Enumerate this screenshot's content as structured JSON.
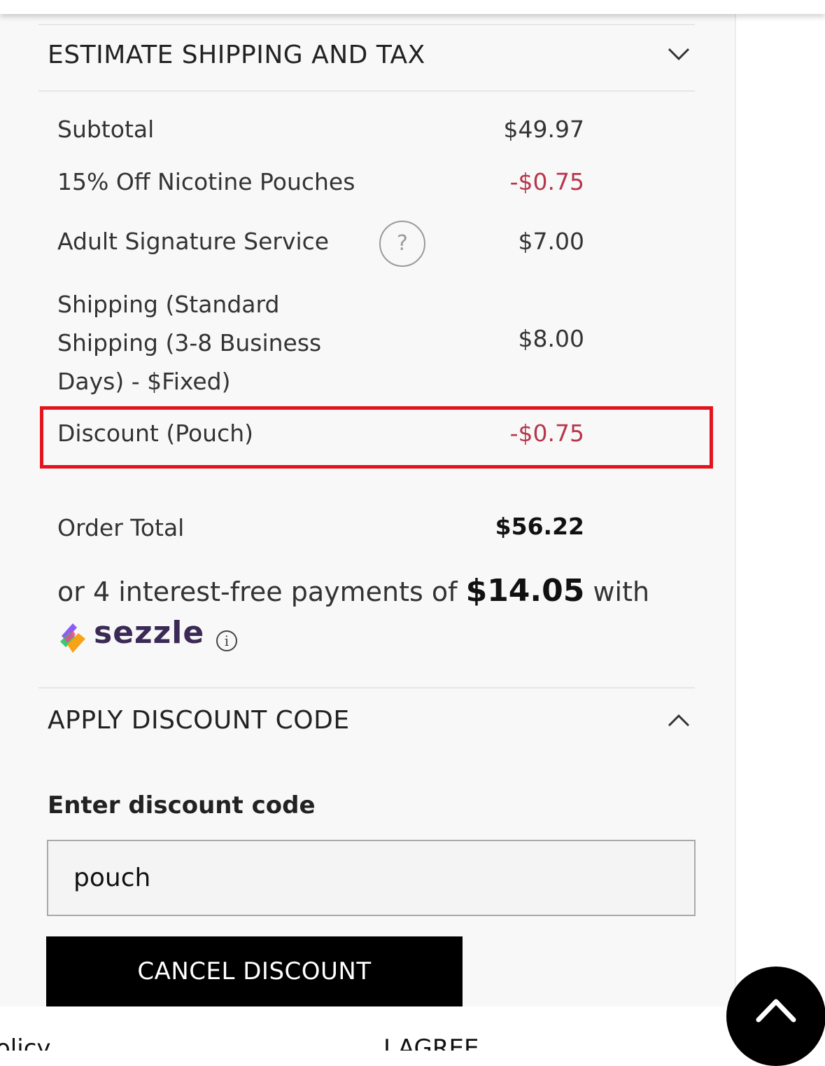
{
  "shipping_section": {
    "title": "ESTIMATE SHIPPING AND TAX"
  },
  "summary": {
    "rows": [
      {
        "label": "Subtotal",
        "value": "$49.97"
      },
      {
        "label": "15% Off Nicotine Pouches",
        "value": "-$0.75"
      },
      {
        "label": "Adult Signature Service",
        "value": "$7.00"
      },
      {
        "label": "Shipping (Standard Shipping (3-8 Business Days) - $Fixed)",
        "value": "$8.00"
      },
      {
        "label": "Discount (Pouch)",
        "value": "-$0.75"
      }
    ],
    "help_glyph": "?",
    "order_total_label": "Order Total",
    "order_total_value": "$56.22"
  },
  "sezzle": {
    "prefix": "or 4 interest-free payments of ",
    "amount": "$14.05",
    "suffix": " with",
    "brand": "sezzle",
    "info_glyph": "i"
  },
  "discount_section": {
    "title": "APPLY DISCOUNT CODE",
    "field_label": "Enter discount code",
    "field_value": "pouch",
    "cancel_label": "CANCEL DISCOUNT"
  },
  "footer": {
    "left_text": "olicy",
    "middle_text": "I AGREE"
  },
  "colors": {
    "negative": "#b7364b",
    "highlight_border": "#e3141e",
    "button_bg": "#000000"
  }
}
